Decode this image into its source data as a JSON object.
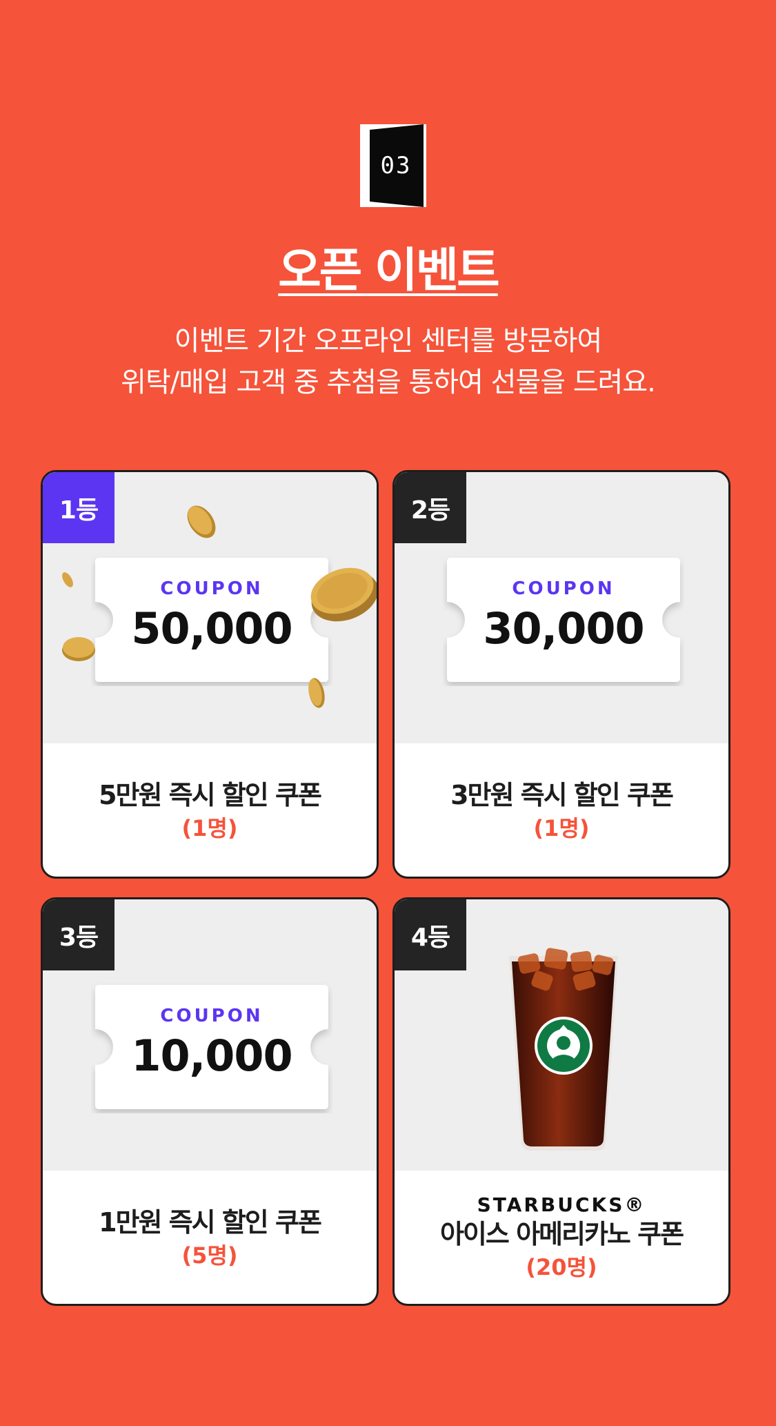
{
  "header": {
    "door_number": "03",
    "title": "오픈 이벤트",
    "description_line1": "이벤트 기간 오프라인 센터를 방문하여",
    "description_line2": "위탁/매입 고객 중 추첨을 통하여 선물을 드려요."
  },
  "prizes": [
    {
      "rank": "1등",
      "coupon_label": "COUPON",
      "amount": "50,000",
      "name": "5만원 즉시 할인 쿠폰",
      "count": "(1명)"
    },
    {
      "rank": "2등",
      "coupon_label": "COUPON",
      "amount": "30,000",
      "name": "3만원 즉시 할인 쿠폰",
      "count": "(1명)"
    },
    {
      "rank": "3등",
      "coupon_label": "COUPON",
      "amount": "10,000",
      "name": "1만원 즉시 할인 쿠폰",
      "count": "(5명)"
    },
    {
      "rank": "4등",
      "brand": "STARBUCKS®",
      "name": "아이스 아메리카노 쿠폰",
      "count": "(20명)"
    }
  ],
  "colors": {
    "background": "#f5533a",
    "accent_purple": "#5b35f2",
    "rank_dark": "#242424"
  },
  "icons": {
    "door": "door-icon",
    "coin": "coin-icon",
    "coffee": "iced-coffee-cup-icon"
  }
}
